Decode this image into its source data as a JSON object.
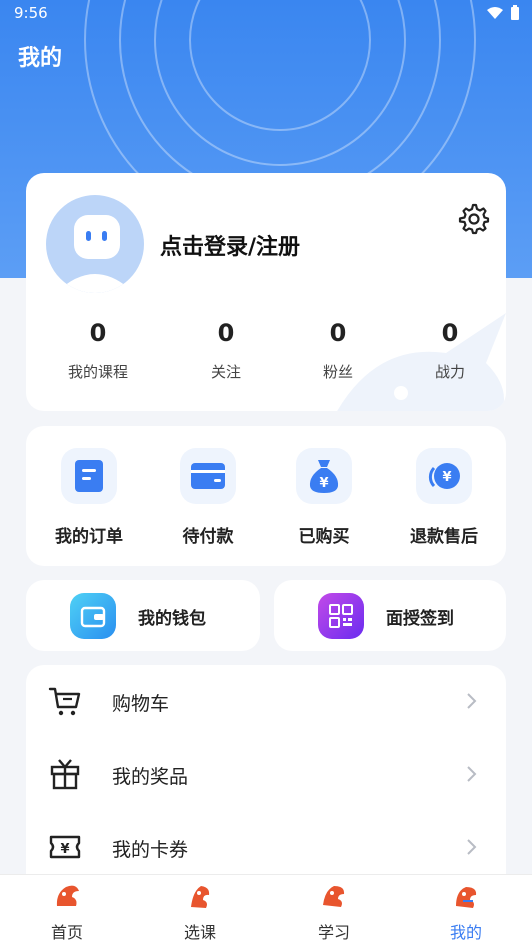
{
  "status_bar": {
    "time": "9:56"
  },
  "page": {
    "title": "我的"
  },
  "profile": {
    "login_text": "点击登录/注册",
    "stats": [
      {
        "value": "0",
        "label": "我的课程"
      },
      {
        "value": "0",
        "label": "关注"
      },
      {
        "value": "0",
        "label": "粉丝"
      },
      {
        "value": "0",
        "label": "战力"
      }
    ]
  },
  "orders": [
    {
      "label": "我的订单",
      "icon": "order-doc-icon"
    },
    {
      "label": "待付款",
      "icon": "card-icon"
    },
    {
      "label": "已购买",
      "icon": "money-bag-icon"
    },
    {
      "label": "退款售后",
      "icon": "refund-icon"
    }
  ],
  "quick": {
    "wallet_label": "我的钱包",
    "checkin_label": "面授签到"
  },
  "menu": [
    {
      "label": "购物车",
      "icon": "cart-icon"
    },
    {
      "label": "我的奖品",
      "icon": "gift-icon"
    },
    {
      "label": "我的卡券",
      "icon": "coupon-icon"
    }
  ],
  "tabs": [
    {
      "label": "首页"
    },
    {
      "label": "选课"
    },
    {
      "label": "学习"
    },
    {
      "label": "我的"
    }
  ],
  "colors": {
    "accent": "#3a7df2",
    "header": "#3a86f0",
    "wallet": "#29a8f5",
    "checkin": "#8a3cf0"
  }
}
